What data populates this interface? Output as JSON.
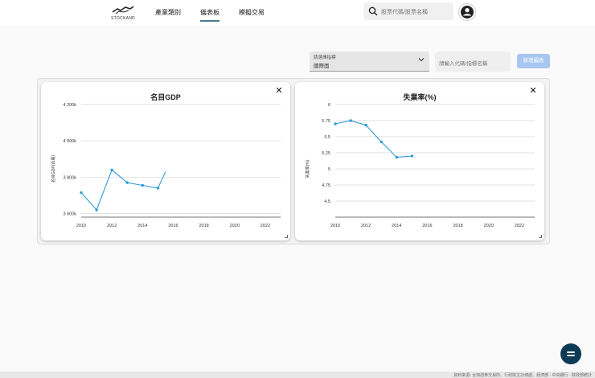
{
  "header": {
    "logo_text": "STOCKAND",
    "nav": [
      {
        "label": "產業類別"
      },
      {
        "label": "儀表板"
      },
      {
        "label": "模擬交易"
      }
    ],
    "search_placeholder": "股票代碼/股票名稱"
  },
  "controls": {
    "select_label": "請選擇指標",
    "select_value": "國際面",
    "input_placeholder": "請輸入代碼/指標名稱",
    "add_button": "新增圖表"
  },
  "footer": {
    "text": "資料來源: 台灣證券交易所、行政院主計總處、經濟部 · 中央銀行 · 財政部統計"
  },
  "chart_data": [
    {
      "type": "line",
      "title": "名目GDP",
      "ylabel": "名目GDP(百萬)",
      "xlabel": "",
      "x": [
        2010,
        2011,
        2012,
        2013,
        2014,
        2015,
        2015.5
      ],
      "values": [
        3715,
        3620,
        3840,
        3770,
        3755,
        3740,
        3830
      ],
      "xticks": [
        "2010",
        "2012",
        "2014",
        "2016",
        "2018",
        "2020",
        "2022"
      ],
      "yticks": [
        "3 600k",
        "3 800k",
        "4 000k",
        "4 200k"
      ],
      "xlim": [
        2010,
        2023
      ],
      "ylim": [
        3580,
        4200
      ],
      "color": "#2f9bd6",
      "grid": true
    },
    {
      "type": "line",
      "title": "失業率(%)",
      "ylabel": "失業率(%)",
      "xlabel": "",
      "x": [
        2010,
        2011,
        2012,
        2013,
        2014,
        2015
      ],
      "values": [
        5.7,
        5.75,
        5.68,
        5.42,
        5.18,
        5.2
      ],
      "xticks": [
        "2010",
        "2012",
        "2014",
        "2016",
        "2018",
        "2020",
        "2022"
      ],
      "yticks": [
        "4.5",
        "4.75",
        "5",
        "5.25",
        "5.5",
        "5.75",
        "6"
      ],
      "xlim": [
        2010,
        2023
      ],
      "ylim": [
        4.25,
        6
      ],
      "color": "#2f9bd6",
      "grid": true
    }
  ]
}
